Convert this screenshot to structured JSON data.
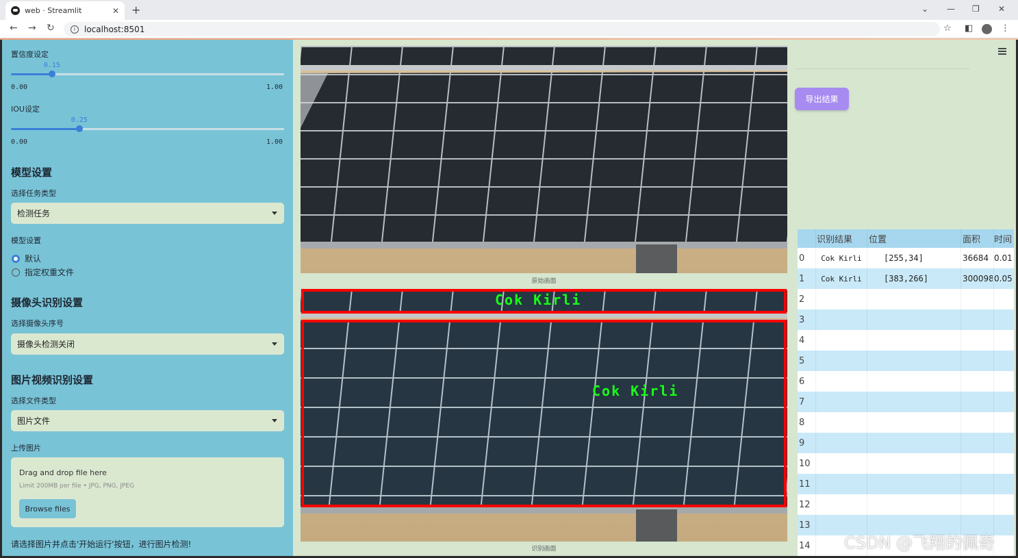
{
  "browser": {
    "tab_title": "web · Streamlit",
    "url": "localhost:8501"
  },
  "sidebar": {
    "conf_label": "置信度设定",
    "conf_value": "0.15",
    "conf_min": "0.00",
    "conf_max": "1.00",
    "conf_fraction": 0.15,
    "iou_label": "IOU设定",
    "iou_value": "0.25",
    "iou_min": "0.00",
    "iou_max": "1.00",
    "iou_fraction": 0.25,
    "model_section": "模型设置",
    "task_label": "选择任务类型",
    "task_value": "检测任务",
    "model_label": "模型设置",
    "radio_default": "默认",
    "radio_custom": "指定权重文件",
    "camera_section": "摄像头识别设置",
    "camera_label": "选择摄像头序号",
    "camera_value": "摄像头检测关闭",
    "media_section": "图片视频识别设置",
    "filetype_label": "选择文件类型",
    "filetype_value": "图片文件",
    "upload_label": "上传图片",
    "drop_title": "Drag and drop file here",
    "drop_limit": "Limit 200MB per file • JPG, PNG, JPEG",
    "browse_label": "Browse files",
    "footer_hint": "请选择图片并点击'开始运行'按钮，进行图片检测!"
  },
  "main": {
    "export_label": "导出结果",
    "caption_original": "原始画面",
    "caption_result": "识别画面",
    "detection_label_1": "Cok  Kirli",
    "detection_label_2": "Cok  Kirli"
  },
  "table": {
    "headers": [
      "识别结果",
      "位置",
      "面积",
      "时间"
    ],
    "rows": [
      {
        "idx": "0",
        "result": "Cok Kirli",
        "pos": "[255,34]",
        "area": "36684",
        "time": "0.01"
      },
      {
        "idx": "1",
        "result": "Cok Kirli",
        "pos": "[383,266]",
        "area": "300098",
        "time": "0.05"
      },
      {
        "idx": "2"
      },
      {
        "idx": "3"
      },
      {
        "idx": "4"
      },
      {
        "idx": "5"
      },
      {
        "idx": "6"
      },
      {
        "idx": "7"
      },
      {
        "idx": "8"
      },
      {
        "idx": "9"
      },
      {
        "idx": "10"
      },
      {
        "idx": "11"
      },
      {
        "idx": "12"
      },
      {
        "idx": "13"
      },
      {
        "idx": "14"
      }
    ]
  },
  "watermark": "CSDN @飞翔的佩奇",
  "colors": {
    "sidebar_bg": "#79c3d7",
    "main_bg": "#d6e6cf",
    "accent": "#3a7fd6",
    "export_button": "#a78bf0",
    "detection_box": "#ff0000",
    "detection_text": "#19ff19"
  }
}
